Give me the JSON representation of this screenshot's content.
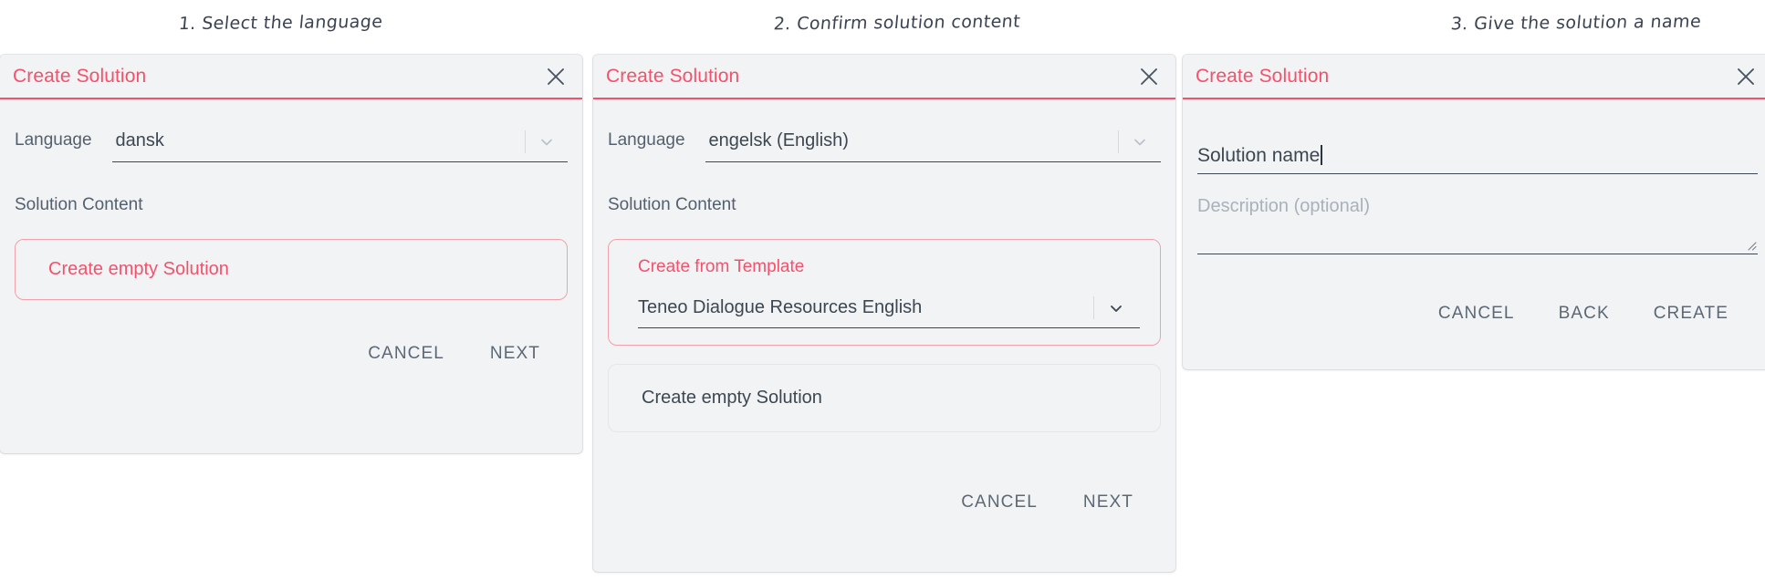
{
  "captions": [
    "1. Select the language",
    "2. Confirm solution content",
    "3. Give the solution a name"
  ],
  "colors": {
    "accent": "#f4516c",
    "accent_soft": "#f2a0ab",
    "panel_bg": "#f1f3f5",
    "text": "#3d4752",
    "muted": "#55606e",
    "placeholder": "#a9b1ba"
  },
  "panel1": {
    "title": "Create Solution",
    "close_icon": "close-icon",
    "language_label": "Language",
    "language_value": "dansk",
    "language_chevron_icon": "chevron-down-icon",
    "section_label": "Solution Content",
    "option_empty": "Create empty Solution",
    "buttons": {
      "cancel": "CANCEL",
      "next": "NEXT"
    }
  },
  "panel2": {
    "title": "Create Solution",
    "close_icon": "close-icon",
    "language_label": "Language",
    "language_value": "engelsk (English)",
    "language_chevron_icon": "chevron-down-icon",
    "section_label": "Solution Content",
    "option_template_title": "Create from Template",
    "template_value": "Teneo Dialogue Resources English",
    "template_chevron_icon": "chevron-down-icon",
    "option_empty": "Create empty Solution",
    "buttons": {
      "cancel": "CANCEL",
      "next": "NEXT"
    }
  },
  "panel3": {
    "title": "Create Solution",
    "close_icon": "close-icon",
    "name_value": "Solution name",
    "description_placeholder": "Description (optional)",
    "resize_icon": "resize-grip-icon",
    "buttons": {
      "cancel": "CANCEL",
      "back": "BACK",
      "create": "CREATE"
    }
  }
}
